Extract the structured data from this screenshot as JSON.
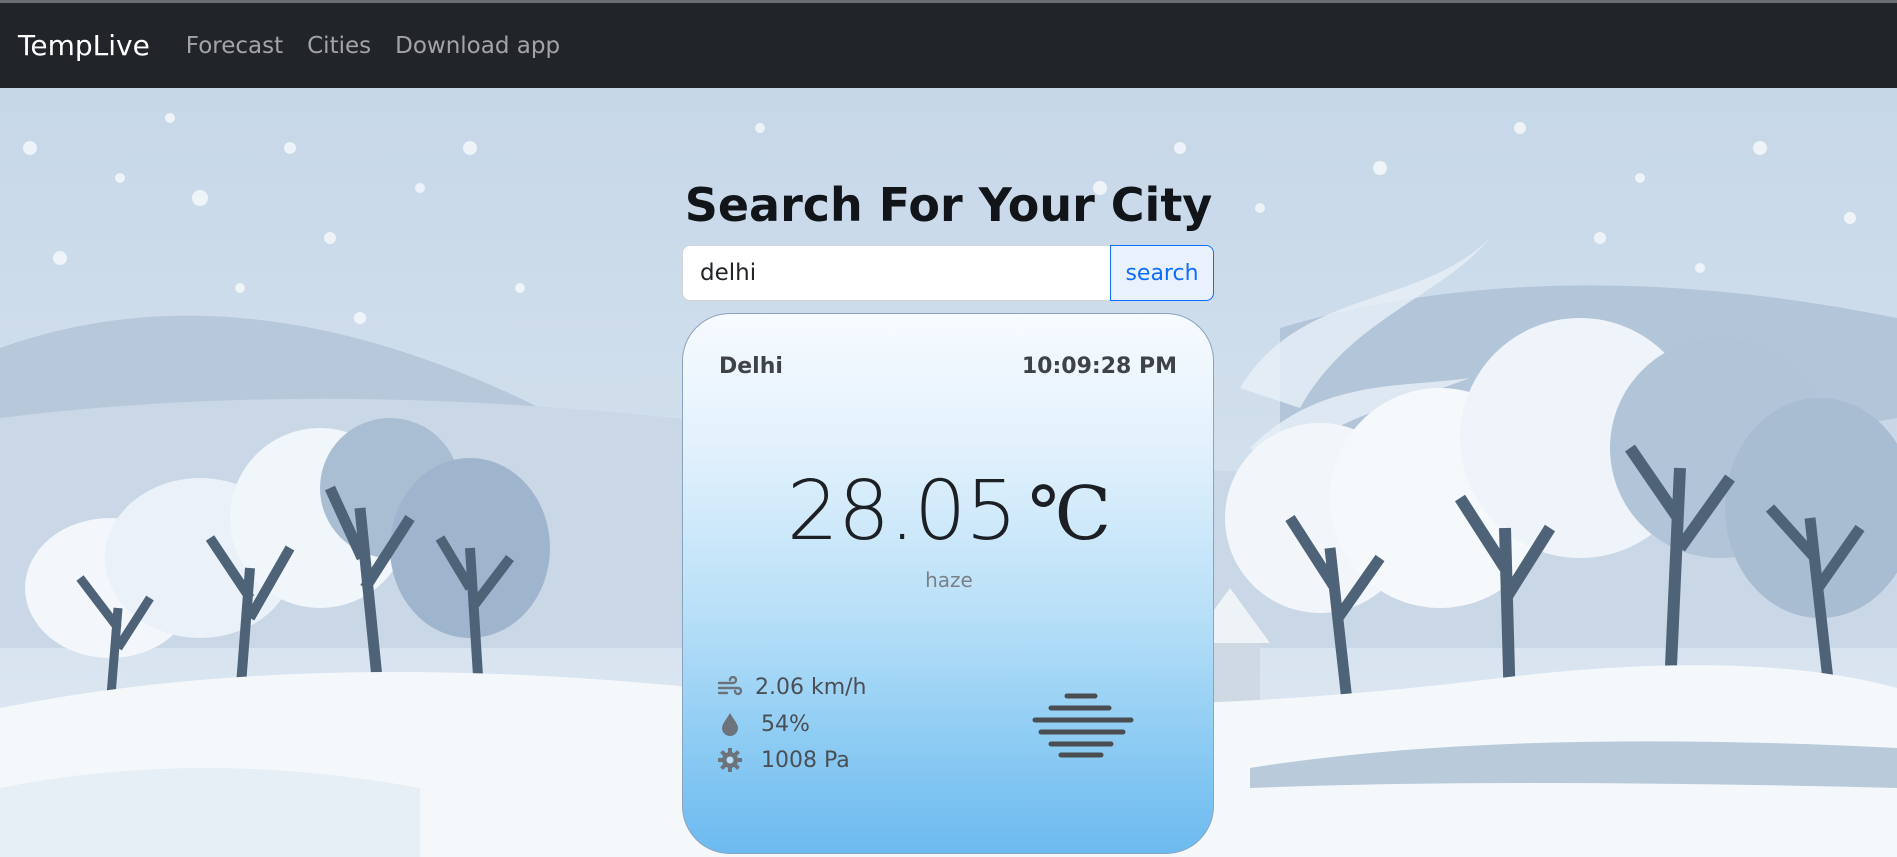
{
  "navbar": {
    "brand": "TempLive",
    "links": [
      "Forecast",
      "Cities",
      "Download app"
    ]
  },
  "main": {
    "heading": "Search For Your City",
    "search": {
      "value": "delhi",
      "button_label": "search"
    }
  },
  "weather": {
    "city": "Delhi",
    "time": "10:09:28 PM",
    "temperature": "28.05",
    "unit": "℃",
    "condition": "haze",
    "wind": "2.06 km/h",
    "humidity": "54%",
    "pressure": "1008 Pa",
    "icons": [
      "wind-icon",
      "droplet-icon",
      "gear-icon",
      "haze-icon"
    ]
  },
  "colors": {
    "navbar": "#212529",
    "accent": "#0d6efd",
    "card_top": "#f7fbff",
    "card_bottom": "#6cbaf0"
  }
}
